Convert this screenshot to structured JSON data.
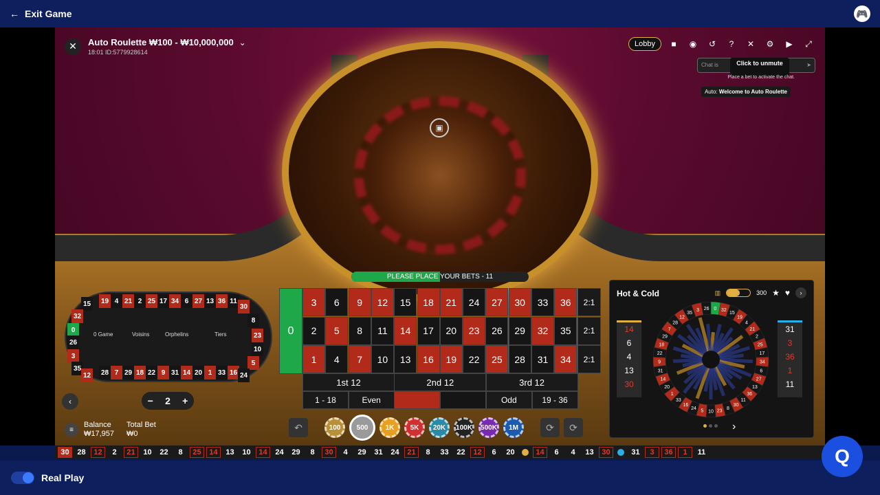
{
  "topbar": {
    "exit_label": "Exit Game",
    "gamepad_icon": "gamepad-icon"
  },
  "game": {
    "title": "Auto Roulette ₩100 - ₩10,000,000",
    "subtitle": "18:01  ID:5779928614"
  },
  "controls": {
    "lobby": "Lobby",
    "icons": [
      "chat-icon",
      "headset-icon",
      "history-icon",
      "help-icon",
      "mute-icon",
      "settings-icon",
      "video-icon",
      "fullscreen-icon"
    ]
  },
  "chat": {
    "placeholder": "Chat is",
    "tooltip": "Click to unmute",
    "note": "Place a bet to activate the chat.",
    "msg_user": "Auto:",
    "msg_text": "Welcome to Auto Roulette"
  },
  "betstatus": {
    "text": "PLEASE PLACE YOUR BETS - 11",
    "progress": 0.5
  },
  "racetrack": {
    "top": [
      "19",
      "4",
      "21",
      "2",
      "25",
      "17",
      "34",
      "6",
      "27",
      "13",
      "36",
      "11"
    ],
    "top_colors": [
      "r",
      "b",
      "r",
      "b",
      "r",
      "b",
      "r",
      "b",
      "r",
      "b",
      "r",
      "b"
    ],
    "bottom": [
      "28",
      "7",
      "29",
      "18",
      "22",
      "9",
      "31",
      "14",
      "20",
      "1",
      "33",
      "16"
    ],
    "bottom_colors": [
      "b",
      "r",
      "b",
      "r",
      "b",
      "r",
      "b",
      "r",
      "b",
      "r",
      "b",
      "r"
    ],
    "left": [
      "15",
      "32",
      "0",
      "26",
      "3",
      "35",
      "12"
    ],
    "left_colors": [
      "b",
      "r",
      "g",
      "b",
      "r",
      "b",
      "r"
    ],
    "right": [
      "30",
      "8",
      "23",
      "10",
      "5",
      "24"
    ],
    "right_colors": [
      "r",
      "b",
      "r",
      "b",
      "r",
      "b"
    ],
    "sections": [
      "0 Game",
      "Voisins",
      "Orphelins",
      "Tiers"
    ]
  },
  "stepper": {
    "minus": "−",
    "value": "2",
    "plus": "+"
  },
  "balance": {
    "label": "Balance",
    "value": "₩17,957",
    "bet_label": "Total Bet",
    "bet_value": "₩0"
  },
  "table": {
    "zero": "0",
    "rows": [
      [
        "3",
        "6",
        "9",
        "12",
        "15",
        "18",
        "21",
        "24",
        "27",
        "30",
        "33",
        "36"
      ],
      [
        "2",
        "5",
        "8",
        "11",
        "14",
        "17",
        "20",
        "23",
        "26",
        "29",
        "32",
        "35"
      ],
      [
        "1",
        "4",
        "7",
        "10",
        "13",
        "16",
        "19",
        "22",
        "25",
        "28",
        "31",
        "34"
      ]
    ],
    "colors": [
      [
        "r",
        "b",
        "r",
        "r",
        "b",
        "r",
        "r",
        "b",
        "r",
        "r",
        "b",
        "r"
      ],
      [
        "b",
        "r",
        "b",
        "b",
        "r",
        "b",
        "b",
        "r",
        "b",
        "b",
        "r",
        "b"
      ],
      [
        "r",
        "b",
        "r",
        "b",
        "b",
        "r",
        "r",
        "b",
        "r",
        "b",
        "b",
        "r"
      ]
    ],
    "columns": [
      "2:1",
      "2:1",
      "2:1"
    ],
    "dozens": [
      "1st 12",
      "2nd 12",
      "3rd 12"
    ],
    "evens": [
      "1 - 18",
      "Even",
      "",
      "",
      "Odd",
      "19 - 36"
    ]
  },
  "chips": [
    "100",
    "500",
    "1K",
    "5K",
    "20K",
    "100K",
    "500K",
    "1M"
  ],
  "chip_colors": [
    "#b8903a",
    "#9a9a9a",
    "#e8a020",
    "#d03030",
    "#2a8aa8",
    "#222222",
    "#7a2ab0",
    "#1a5ab0"
  ],
  "hotcold": {
    "title": "Hot & Cold",
    "count": "300",
    "hot": [
      "14",
      "6",
      "4",
      "13",
      "30"
    ],
    "hot_colors": [
      "r",
      "b",
      "b",
      "b",
      "r"
    ],
    "cold": [
      "31",
      "3",
      "36",
      "1",
      "11"
    ],
    "cold_colors": [
      "b",
      "r",
      "r",
      "r",
      "b"
    ],
    "level": 0.55,
    "wheel": [
      "0",
      "32",
      "15",
      "19",
      "4",
      "21",
      "2",
      "25",
      "17",
      "34",
      "6",
      "27",
      "13",
      "36",
      "11",
      "30",
      "8",
      "23",
      "10",
      "5",
      "24",
      "16",
      "33",
      "1",
      "20",
      "14",
      "31",
      "9",
      "22",
      "18",
      "29",
      "7",
      "28",
      "12",
      "35",
      "3",
      "26"
    ]
  },
  "results": [
    {
      "v": "30",
      "c": "first"
    },
    {
      "v": "28",
      "c": "b"
    },
    {
      "v": "12",
      "c": "r"
    },
    {
      "v": "2",
      "c": "b"
    },
    {
      "v": "21",
      "c": "r"
    },
    {
      "v": "10",
      "c": "b"
    },
    {
      "v": "22",
      "c": "b"
    },
    {
      "v": "8",
      "c": "b"
    },
    {
      "v": "25",
      "c": "r"
    },
    {
      "v": "14",
      "c": "r"
    },
    {
      "v": "13",
      "c": "b"
    },
    {
      "v": "10",
      "c": "b"
    },
    {
      "v": "14",
      "c": "r"
    },
    {
      "v": "24",
      "c": "b"
    },
    {
      "v": "29",
      "c": "b"
    },
    {
      "v": "8",
      "c": "b"
    },
    {
      "v": "30",
      "c": "r"
    },
    {
      "v": "4",
      "c": "b"
    },
    {
      "v": "29",
      "c": "b"
    },
    {
      "v": "31",
      "c": "b"
    },
    {
      "v": "24",
      "c": "b"
    },
    {
      "v": "21",
      "c": "r"
    },
    {
      "v": "8",
      "c": "b"
    },
    {
      "v": "33",
      "c": "b"
    },
    {
      "v": "22",
      "c": "b"
    },
    {
      "v": "12",
      "c": "r"
    },
    {
      "v": "6",
      "c": "b"
    },
    {
      "v": "20",
      "c": "b"
    }
  ],
  "results_hot": [
    {
      "v": "14",
      "c": "r"
    },
    {
      "v": "6",
      "c": "b"
    },
    {
      "v": "4",
      "c": "b"
    },
    {
      "v": "13",
      "c": "b"
    },
    {
      "v": "30",
      "c": "r"
    }
  ],
  "results_cold": [
    {
      "v": "31",
      "c": "b"
    },
    {
      "v": "3",
      "c": "r"
    },
    {
      "v": "36",
      "c": "r"
    },
    {
      "v": "1",
      "c": "r"
    },
    {
      "v": "11",
      "c": "b"
    }
  ],
  "bottombar": {
    "label": "Real Play"
  },
  "help": {
    "icon": "help-chat-icon"
  }
}
